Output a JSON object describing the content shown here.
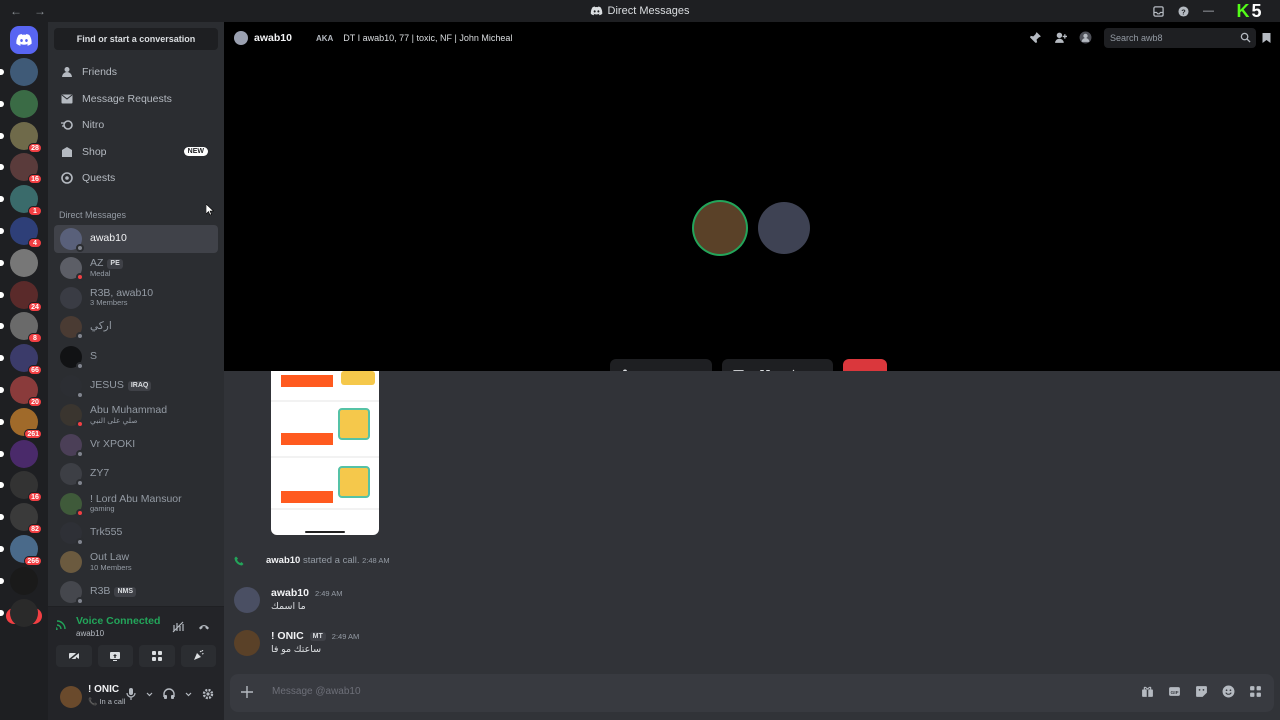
{
  "titlebar": {
    "title": "Direct Messages",
    "back": "←",
    "forward": "→"
  },
  "servers": [
    {
      "badge": ""
    },
    {
      "badge": ""
    },
    {
      "badge": "28"
    },
    {
      "badge": "16"
    },
    {
      "badge": "1"
    },
    {
      "badge": "4"
    },
    {
      "badge": ""
    },
    {
      "badge": "24"
    },
    {
      "badge": "8"
    },
    {
      "badge": "66"
    },
    {
      "badge": "20"
    },
    {
      "badge": "261"
    },
    {
      "badge": ""
    },
    {
      "badge": "16"
    },
    {
      "badge": "82"
    },
    {
      "badge": "266"
    },
    {
      "badge": ""
    },
    {
      "badge": ""
    }
  ],
  "new_label": "NEW",
  "sidebar": {
    "find": "Find or start a conversation",
    "nav": [
      {
        "label": "Friends",
        "icon": "friends-icon"
      },
      {
        "label": "Message Requests",
        "icon": "mail-icon"
      },
      {
        "label": "Nitro",
        "icon": "nitro-icon"
      },
      {
        "label": "Shop",
        "icon": "shop-icon",
        "tag": "NEW"
      },
      {
        "label": "Quests",
        "icon": "quests-icon"
      }
    ],
    "dm_header": "Direct Messages",
    "dms": [
      {
        "name": "awab10",
        "sub": "",
        "tag": "",
        "active": true,
        "color": "#59607a",
        "status": "#80848e"
      },
      {
        "name": "AZ",
        "sub": "Medal",
        "tag": "PE",
        "active": false,
        "color": "#5c5e66",
        "status": "#f23f43"
      },
      {
        "name": "R3B, awab10",
        "sub": "3 Members",
        "tag": "",
        "active": false,
        "color": "#3a3c44",
        "status": ""
      },
      {
        "name": "اركي",
        "sub": "",
        "tag": "",
        "active": false,
        "color": "#4a3b33",
        "status": "#80848e"
      },
      {
        "name": "S",
        "sub": "",
        "tag": "",
        "active": false,
        "color": "#111214",
        "status": "#80848e"
      },
      {
        "name": "JESUS",
        "sub": "",
        "tag": "IRAQ",
        "active": false,
        "color": "#2c2e33",
        "status": "#80848e"
      },
      {
        "name": "Abu Muhammad",
        "sub": "صلي على النبي",
        "tag": "",
        "active": false,
        "color": "#3a352f",
        "status": "#f23f43"
      },
      {
        "name": "Vr XPOKI",
        "sub": "",
        "tag": "",
        "active": false,
        "color": "#4b3f57",
        "status": "#80848e"
      },
      {
        "name": "ZY7",
        "sub": "",
        "tag": "",
        "active": false,
        "color": "#3d3f45",
        "status": "#80848e"
      },
      {
        "name": "! Lord Abu Mansuor",
        "sub": "gaming",
        "tag": "",
        "active": false,
        "color": "#3f5a3a",
        "status": "#f23f43"
      },
      {
        "name": "Trk555",
        "sub": "",
        "tag": "",
        "active": false,
        "color": "#2e3036",
        "status": "#80848e"
      },
      {
        "name": "Out Law",
        "sub": "10 Members",
        "tag": "",
        "active": false,
        "color": "#6b5a3f",
        "status": ""
      },
      {
        "name": "R3B",
        "sub": "",
        "tag": "NMS",
        "active": false,
        "color": "#45474d",
        "status": "#80848e"
      }
    ]
  },
  "voice": {
    "status": "Voice Connected",
    "channel": "awab10"
  },
  "user": {
    "name": "! ONIC",
    "status": "In a call"
  },
  "header": {
    "name": "awab10",
    "aka_label": "AKA",
    "aka_value": "DT I awab10, 77 | toxic, NF | John Micheal",
    "search_placeholder": "Search awb8"
  },
  "call": {
    "participants": [
      {
        "color": "#5a4128",
        "speaking": true
      },
      {
        "color": "#3e4253",
        "speaking": false
      }
    ]
  },
  "chat": {
    "system": {
      "user": "awab10",
      "text": "started a call.",
      "time": "2:48 AM"
    },
    "messages": [
      {
        "user": "awab10",
        "time": "2:49 AM",
        "text": "ما اسمك",
        "tag": "",
        "color": "#4a4f63"
      },
      {
        "user": "! ONIC",
        "time": "2:49 AM",
        "text": "ساعتك مو فا",
        "tag": "MT",
        "color": "#5a4128"
      }
    ]
  },
  "composer": {
    "placeholder": "Message @awab10"
  },
  "colors": {
    "accent": "#5865f2",
    "danger": "#da373c",
    "online": "#23a55a"
  }
}
